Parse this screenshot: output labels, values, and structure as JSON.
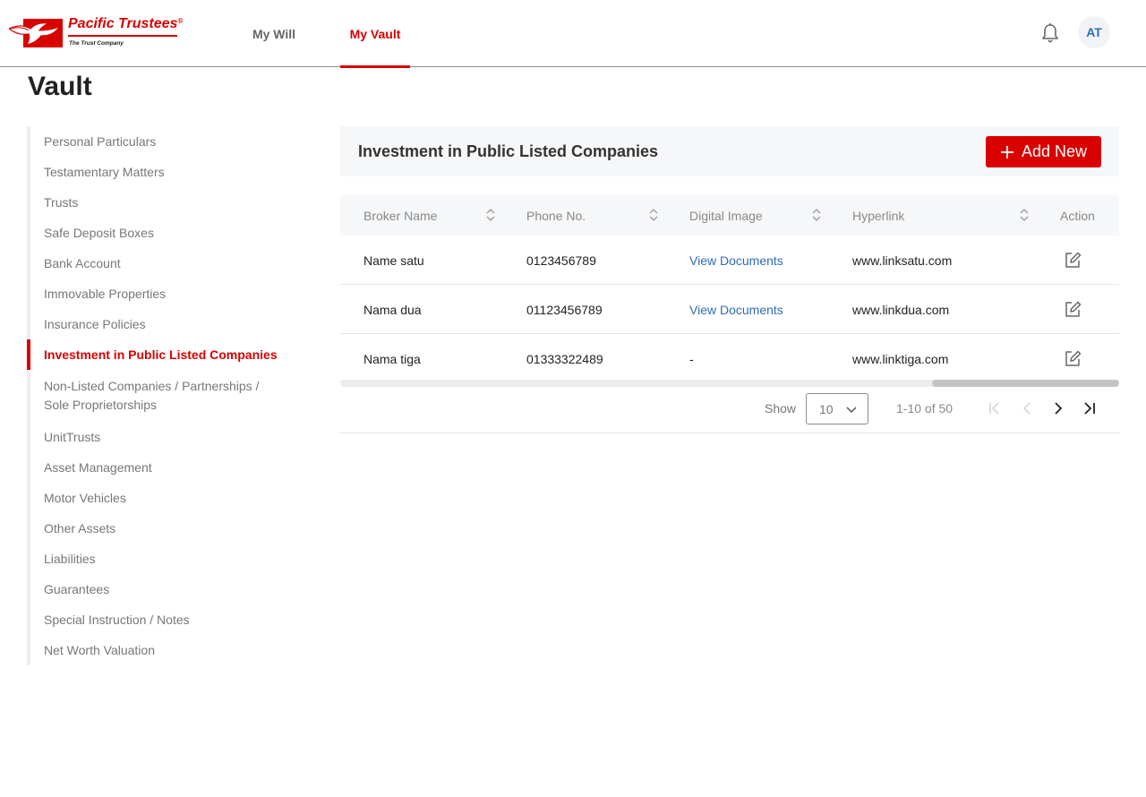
{
  "header": {
    "logo_brand": "Pacific Trustees",
    "logo_reg": "®",
    "logo_tagline": "The Trust Company",
    "nav_tabs": [
      {
        "label": "My Will",
        "active": false
      },
      {
        "label": "My Vault",
        "active": true
      }
    ],
    "notification_icon": "bell-icon",
    "avatar_initials": "AT"
  },
  "page": {
    "title": "Vault"
  },
  "sidebar": {
    "items": [
      {
        "label": "Personal Particulars",
        "active": false
      },
      {
        "label": "Testamentary Matters",
        "active": false
      },
      {
        "label": "Trusts",
        "active": false
      },
      {
        "label": "Safe Deposit Boxes",
        "active": false
      },
      {
        "label": "Bank Account",
        "active": false
      },
      {
        "label": "Immovable Properties",
        "active": false
      },
      {
        "label": "Insurance Policies",
        "active": false
      },
      {
        "label": "Investment in Public Listed Companies",
        "active": true
      },
      {
        "label": "Non-Listed Companies / Partnerships / Sole Proprietorships",
        "active": false
      },
      {
        "label": "UnitTrusts",
        "active": false
      },
      {
        "label": "Asset Management",
        "active": false
      },
      {
        "label": "Motor Vehicles",
        "active": false
      },
      {
        "label": "Other Assets",
        "active": false
      },
      {
        "label": "Liabilities",
        "active": false
      },
      {
        "label": "Guarantees",
        "active": false
      },
      {
        "label": "Special Instruction / Notes",
        "active": false
      },
      {
        "label": "Net Worth Valuation",
        "active": false
      }
    ]
  },
  "main": {
    "section_title": "Investment in Public Listed Companies",
    "add_button_label": "Add New",
    "table": {
      "columns": [
        {
          "label": "Broker Name",
          "sortable": true
        },
        {
          "label": "Phone No.",
          "sortable": true
        },
        {
          "label": "Digital Image",
          "sortable": true
        },
        {
          "label": "Hyperlink",
          "sortable": true
        },
        {
          "label": "Action",
          "sortable": false
        }
      ],
      "rows": [
        {
          "broker": "Name satu",
          "phone": "0123456789",
          "image": "View Documents",
          "hyperlink": "www.linksatu.com",
          "action_icon": "edit-icon"
        },
        {
          "broker": "Nama dua",
          "phone": "01123456789",
          "image": "View Documents",
          "hyperlink": "www.linkdua.com",
          "action_icon": "edit-icon"
        },
        {
          "broker": "Nama tiga",
          "phone": "01333322489",
          "image": "-",
          "hyperlink": "www.linktiga.com",
          "action_icon": "edit-icon"
        }
      ]
    },
    "pagination": {
      "show_label": "Show",
      "page_size": "10",
      "range_text": "1-10 of 50"
    }
  },
  "colors": {
    "brand_red": "#d90000",
    "link_blue": "#2f6db5",
    "header_bg": "#f6f7f9"
  }
}
